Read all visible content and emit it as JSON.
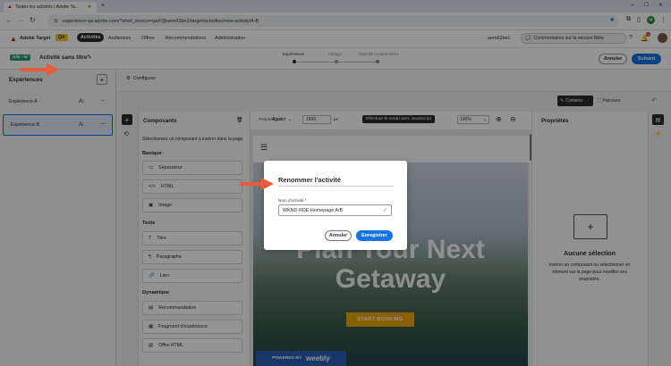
{
  "browser": {
    "tab_title": "Toutes les activités | Adobe Ta...",
    "url": "experience-qa.adobe.com/?shell_source=qa#/@aem62be1/target/activities/new-activity/A-B"
  },
  "app": {
    "product": "Adobe Target",
    "env_badge": "QA",
    "nav": [
      "Activités",
      "Audiences",
      "Offres",
      "Recommendations",
      "Administration"
    ],
    "org": "aem62be1",
    "beta_label": "Commentaires sur la version Bêta",
    "notif_count": "9"
  },
  "activity": {
    "type_badge": "A/B - M",
    "title": "Activité sans titre",
    "steps": [
      "Expériences",
      "Ciblage",
      "Objectifs et paramètres"
    ],
    "cancel_label": "Annuler",
    "next_label": "Suivant"
  },
  "experiences": {
    "header": "Expériences",
    "items": [
      "Expérience A",
      "Expérience B"
    ]
  },
  "toolbar": {
    "configure_label": "Configurer",
    "contenu_label": "Contenu",
    "parcours_label": "Parcours",
    "peripherique_label": "Périphérique",
    "peripherique_value": "Ajuster",
    "width_value": "1650",
    "width_unit": "px",
    "render_label": "Effectuer le rendu avec JavaScript",
    "zoom_value": "100%"
  },
  "components": {
    "header": "Composants",
    "description": "Sélectionnez un composant à insérer dans la page",
    "groups": [
      {
        "title": "Basique",
        "items": [
          "Séparateur",
          "HTML",
          "Image"
        ]
      },
      {
        "title": "Texte",
        "items": [
          "Titre",
          "Paragraphe",
          "Lien"
        ]
      },
      {
        "title": "Dynamique",
        "items": [
          "Recommandation",
          "Fragment d'expérience",
          "Offre HTML"
        ]
      }
    ]
  },
  "properties": {
    "header": "Propriétés",
    "empty_title": "Aucune sélection",
    "empty_desc": "Insérer un composant ou sélectionner un élément sur la page pour modifier ses propriétés."
  },
  "preview": {
    "hero_line1": "Plan Your Next",
    "hero_line2": "Getaway",
    "cta": "START BOOKING",
    "footer_prefix": "POWERED BY",
    "footer_brand": "weebly"
  },
  "dialog": {
    "title": "Renommer l'activité",
    "field_label": "Nom d'activité",
    "field_required": "*",
    "field_value": "WKND RDE Homepage A/B",
    "cancel_label": "Annuler",
    "save_label": "Enregistrer"
  },
  "colors": {
    "accent": "#1473e6",
    "brand_red": "#eb1000",
    "cta_orange": "#f0a500",
    "arrow": "#ea5a3c"
  }
}
